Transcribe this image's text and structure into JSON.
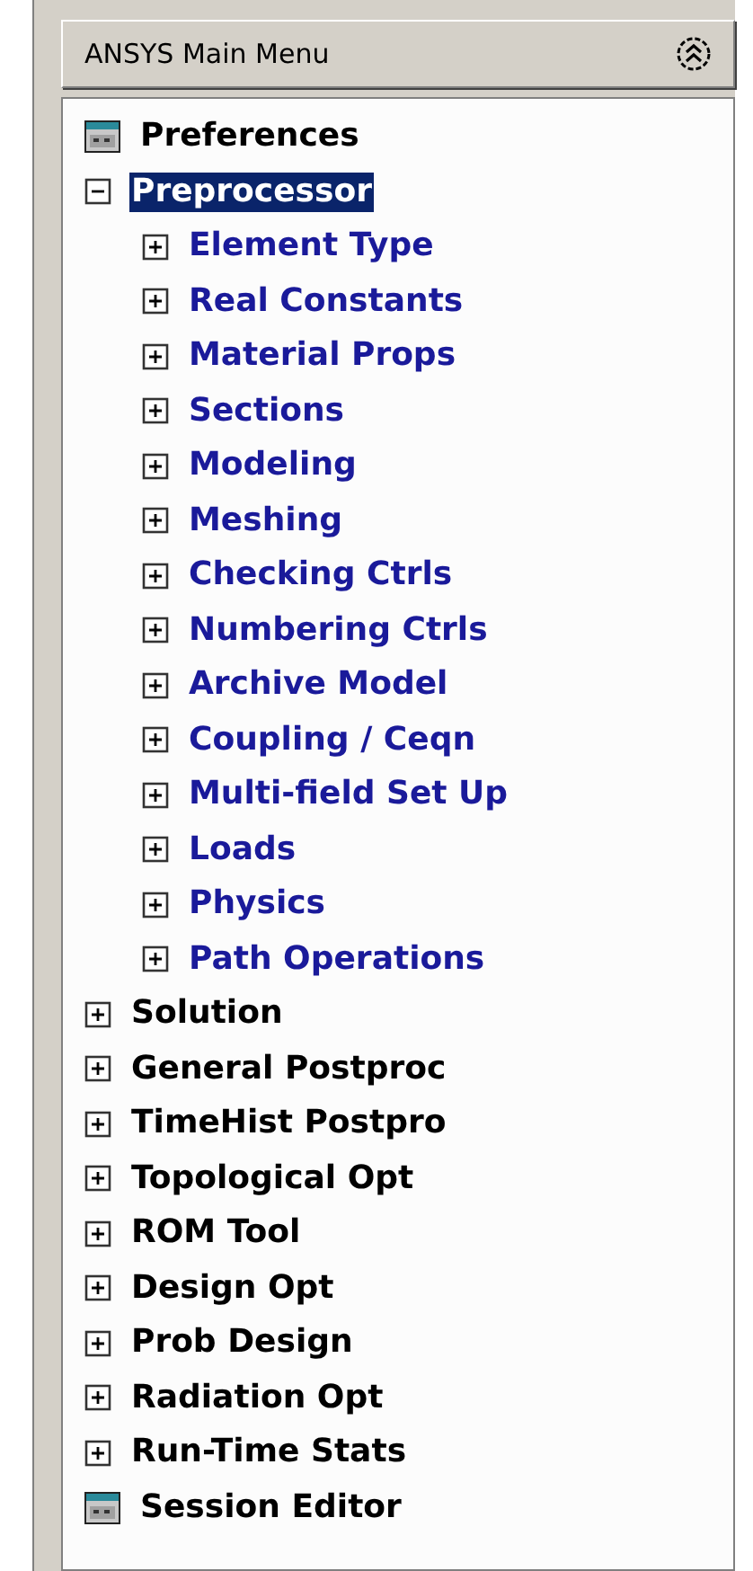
{
  "panel": {
    "title": "ANSYS Main Menu"
  },
  "tree": [
    {
      "label": "Preferences",
      "kind": "dialog",
      "selected": false
    },
    {
      "label": "Preprocessor",
      "kind": "folder",
      "expanded": true,
      "selected": true,
      "children": [
        {
          "label": "Element Type",
          "kind": "folder",
          "expanded": false,
          "selected": false
        },
        {
          "label": "Real Constants",
          "kind": "folder",
          "expanded": false,
          "selected": false
        },
        {
          "label": "Material Props",
          "kind": "folder",
          "expanded": false,
          "selected": false
        },
        {
          "label": "Sections",
          "kind": "folder",
          "expanded": false,
          "selected": false
        },
        {
          "label": "Modeling",
          "kind": "folder",
          "expanded": false,
          "selected": false
        },
        {
          "label": "Meshing",
          "kind": "folder",
          "expanded": false,
          "selected": false
        },
        {
          "label": "Checking Ctrls",
          "kind": "folder",
          "expanded": false,
          "selected": false
        },
        {
          "label": "Numbering Ctrls",
          "kind": "folder",
          "expanded": false,
          "selected": false
        },
        {
          "label": "Archive Model",
          "kind": "folder",
          "expanded": false,
          "selected": false
        },
        {
          "label": "Coupling / Ceqn",
          "kind": "folder",
          "expanded": false,
          "selected": false
        },
        {
          "label": "Multi-field Set Up",
          "kind": "folder",
          "expanded": false,
          "selected": false
        },
        {
          "label": "Loads",
          "kind": "folder",
          "expanded": false,
          "selected": false
        },
        {
          "label": "Physics",
          "kind": "folder",
          "expanded": false,
          "selected": false
        },
        {
          "label": "Path Operations",
          "kind": "folder",
          "expanded": false,
          "selected": false
        }
      ]
    },
    {
      "label": "Solution",
      "kind": "folder",
      "expanded": false,
      "selected": false
    },
    {
      "label": "General Postproc",
      "kind": "folder",
      "expanded": false,
      "selected": false
    },
    {
      "label": "TimeHist Postpro",
      "kind": "folder",
      "expanded": false,
      "selected": false
    },
    {
      "label": "Topological Opt",
      "kind": "folder",
      "expanded": false,
      "selected": false
    },
    {
      "label": "ROM Tool",
      "kind": "folder",
      "expanded": false,
      "selected": false
    },
    {
      "label": "Design Opt",
      "kind": "folder",
      "expanded": false,
      "selected": false
    },
    {
      "label": "Prob Design",
      "kind": "folder",
      "expanded": false,
      "selected": false
    },
    {
      "label": "Radiation Opt",
      "kind": "folder",
      "expanded": false,
      "selected": false
    },
    {
      "label": "Run-Time Stats",
      "kind": "folder",
      "expanded": false,
      "selected": false
    },
    {
      "label": "Session Editor",
      "kind": "dialog",
      "selected": false
    }
  ]
}
